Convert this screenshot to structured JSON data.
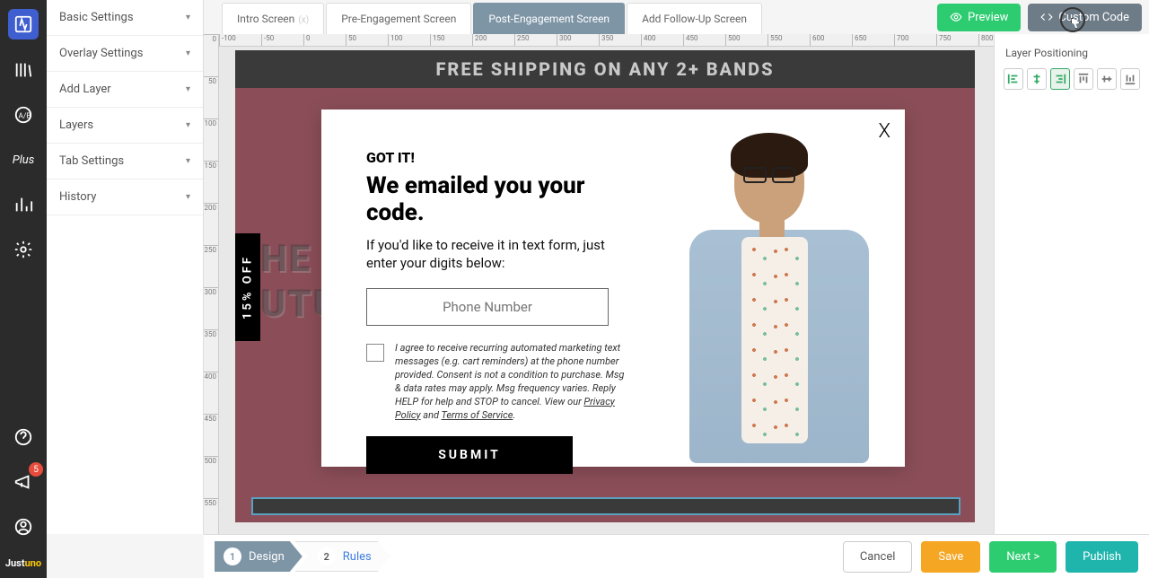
{
  "leftnav": {
    "badge_count": "5",
    "logo_left": "Just",
    "logo_right": "uno",
    "plus_label": "Plus"
  },
  "leftpanel": {
    "sections": [
      "Basic Settings",
      "Overlay Settings",
      "Add Layer",
      "Layers",
      "Tab Settings",
      "History"
    ]
  },
  "tabs": {
    "items": [
      {
        "label": "Intro Screen",
        "closable": true
      },
      {
        "label": "Pre-Engagement Screen"
      },
      {
        "label": "Post-Engagement Screen",
        "active": true
      },
      {
        "label": "Add Follow-Up Screen"
      }
    ]
  },
  "topbuttons": {
    "preview": "Preview",
    "custom_code": "Custom Code"
  },
  "ruler_h": [
    "-100",
    "-50",
    "0",
    "50",
    "100",
    "150",
    "200",
    "250",
    "300",
    "350",
    "400",
    "450",
    "500",
    "550",
    "600",
    "650",
    "700",
    "750",
    "800"
  ],
  "ruler_v": [
    "0",
    "50",
    "100",
    "150",
    "200",
    "250",
    "300",
    "350",
    "400",
    "450",
    "500",
    "550"
  ],
  "canvas": {
    "banner": "FREE SHIPPING ON ANY 2+ BANDS",
    "offer_tab": "15% OFF",
    "bg_line1": "HE",
    "bg_line2": "UTU"
  },
  "popup": {
    "gotit": "GOT IT!",
    "headline": "We emailed you your code.",
    "sub": "If you'd like to receive it in text form, just enter your digits below:",
    "phone_placeholder": "Phone Number",
    "consent_pre": "I agree to receive recurring automated marketing text messages (e.g. cart reminders) at the phone number provided. Consent is not a condition to purchase. Msg & data rates may apply. Msg frequency varies. Reply HELP for help and STOP to cancel. View our ",
    "privacy": "Privacy Policy",
    "and": " and ",
    "tos": "Terms of Service",
    "period": ".",
    "submit": "SUBMIT",
    "close": "X"
  },
  "rightpanel": {
    "title": "Layer Positioning"
  },
  "steps": {
    "s1_num": "1",
    "s1_label": "Design",
    "s2_num": "2",
    "s2_label": "Rules"
  },
  "bottombtns": {
    "cancel": "Cancel",
    "save": "Save",
    "next": "Next >",
    "publish": "Publish"
  }
}
